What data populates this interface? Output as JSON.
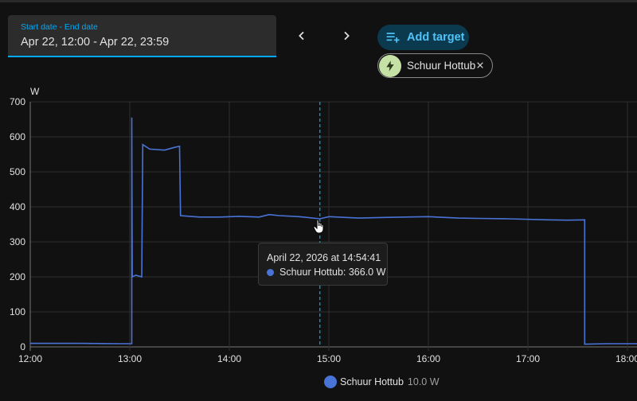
{
  "date_picker": {
    "label": "Start date - End date",
    "value": "Apr 22, 12:00 - Apr 22, 23:59"
  },
  "nav": {
    "prev_icon": "chevron-left-icon",
    "next_icon": "chevron-right-icon"
  },
  "add_target": {
    "label": "Add target",
    "icon": "playlist-plus-icon"
  },
  "target_chip": {
    "label": "Schuur Hottub",
    "icon": "lightning-bolt-icon",
    "icon_bg": "#c5e1a5"
  },
  "tooltip": {
    "date": "April 22, 2026 at 14:54:41",
    "series": "Schuur Hottub",
    "value": "366.0 W",
    "text": "Schuur Hottub: 366.0 W"
  },
  "legend": {
    "name": "Schuur Hottub",
    "value": "10.0 W",
    "color": "#4a73d8"
  },
  "colors": {
    "accent": "#03a9f4",
    "series": "#4a73d8",
    "background": "#111111"
  },
  "chart_data": {
    "type": "line",
    "ylabel": "W",
    "ylim": [
      0,
      700
    ],
    "y_ticks": [
      "0",
      "100",
      "200",
      "300",
      "400",
      "500",
      "600",
      "700"
    ],
    "x_ticks": [
      "12:00",
      "13:00",
      "14:00",
      "15:00",
      "16:00",
      "17:00",
      "18:00"
    ],
    "x_unit": "hours",
    "grid": true,
    "hover_x": 14.91,
    "series": [
      {
        "name": "Schuur Hottub",
        "points": [
          [
            12.0,
            10
          ],
          [
            12.5,
            10
          ],
          [
            12.9,
            9
          ],
          [
            13.02,
            9
          ],
          [
            13.02,
            655
          ],
          [
            13.025,
            200
          ],
          [
            13.06,
            205
          ],
          [
            13.12,
            200
          ],
          [
            13.13,
            578
          ],
          [
            13.2,
            565
          ],
          [
            13.35,
            562
          ],
          [
            13.45,
            570
          ],
          [
            13.5,
            573
          ],
          [
            13.51,
            375
          ],
          [
            13.7,
            371
          ],
          [
            13.9,
            371
          ],
          [
            14.1,
            373
          ],
          [
            14.3,
            371
          ],
          [
            14.4,
            378
          ],
          [
            14.5,
            375
          ],
          [
            14.7,
            372
          ],
          [
            14.91,
            366
          ],
          [
            15.0,
            372
          ],
          [
            15.3,
            368
          ],
          [
            15.6,
            370
          ],
          [
            16.0,
            372
          ],
          [
            16.3,
            368
          ],
          [
            16.5,
            367
          ],
          [
            16.8,
            366
          ],
          [
            17.2,
            363
          ],
          [
            17.4,
            362
          ],
          [
            17.57,
            363
          ],
          [
            17.57,
            8
          ],
          [
            17.8,
            9
          ],
          [
            18.1,
            9
          ]
        ]
      }
    ]
  }
}
